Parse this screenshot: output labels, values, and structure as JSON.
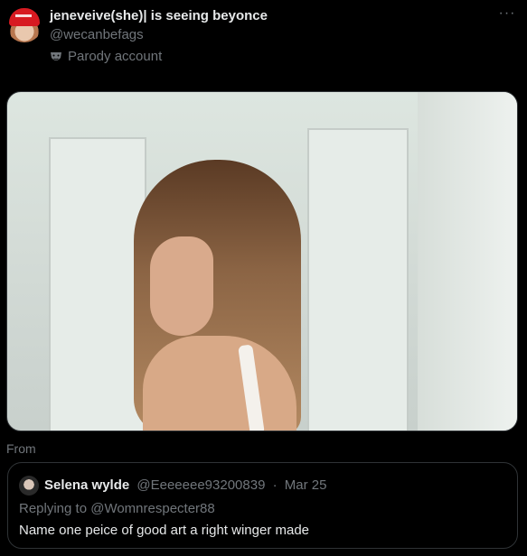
{
  "author": {
    "display_name": "jeneveive(she)| is seeing beyonce",
    "handle": "@wecanbefags",
    "label": "Parody account",
    "avatar_icon": "profile-photo-red-hat",
    "label_icon": "theater-mask-icon"
  },
  "more_icon": "more-icon",
  "media": {
    "type": "video-still",
    "source_label": "From"
  },
  "quoted": {
    "name": "Selena wylde",
    "handle": "@Eeeeeee93200839",
    "separator": "·",
    "date": "Mar 25",
    "replying_to_prefix": "Replying to ",
    "replying_to_handle": "@Womnrespecter88",
    "text": "Name one peice of good art a right winger made"
  },
  "colors": {
    "background": "#000000",
    "text": "#e7e9ea",
    "muted": "#71767b",
    "border": "#2f3336"
  }
}
